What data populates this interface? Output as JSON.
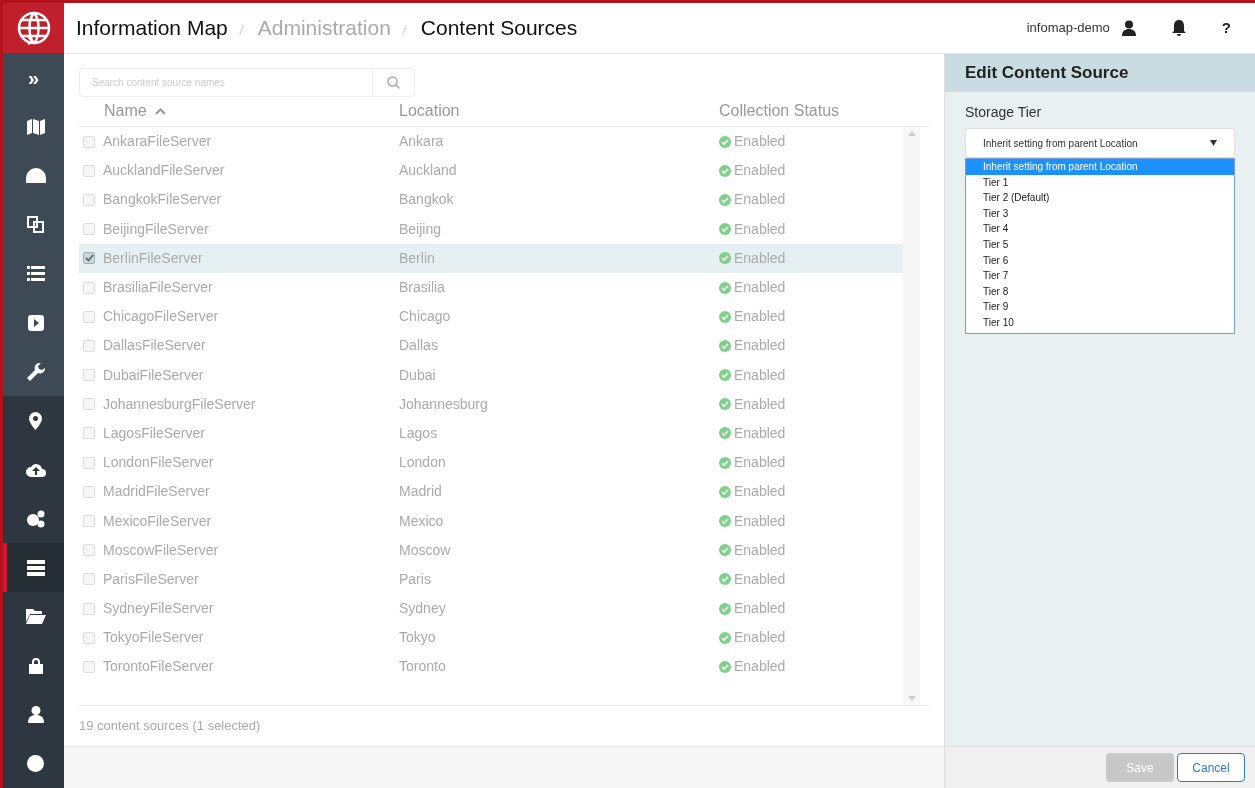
{
  "breadcrumb": [
    {
      "label": "Information Map",
      "muted": false
    },
    {
      "label": "Administration",
      "muted": true
    },
    {
      "label": "Content Sources",
      "muted": false
    }
  ],
  "user": {
    "name": "infomap-demo",
    "help": "?"
  },
  "sidebar": {
    "expand": "»",
    "nav_items": [
      {
        "selected": false
      },
      {
        "selected": false
      },
      {
        "selected": false
      },
      {
        "selected": false
      },
      {
        "selected": false
      },
      {
        "selected": false
      }
    ],
    "admin_items": [
      {
        "selected": false
      },
      {
        "selected": false
      },
      {
        "selected": false
      },
      {
        "selected": true
      },
      {
        "selected": false
      },
      {
        "selected": false
      },
      {
        "selected": false
      },
      {
        "selected": false
      }
    ]
  },
  "search": {
    "placeholder": "Search content source names"
  },
  "table": {
    "columns": [
      {
        "label": "Name",
        "sorted": true
      },
      {
        "label": "Location",
        "sorted": false
      },
      {
        "label": "Collection Status",
        "sorted": false
      }
    ],
    "rows": [
      {
        "name": "AnkaraFileServer",
        "location": "Ankara",
        "status": "Enabled",
        "checked": false,
        "selected": false
      },
      {
        "name": "AucklandFileServer",
        "location": "Auckland",
        "status": "Enabled",
        "checked": false,
        "selected": false
      },
      {
        "name": "BangkokFileServer",
        "location": "Bangkok",
        "status": "Enabled",
        "checked": false,
        "selected": false
      },
      {
        "name": "BeijingFileServer",
        "location": "Beijing",
        "status": "Enabled",
        "checked": false,
        "selected": false
      },
      {
        "name": "BerlinFileServer",
        "location": "Berlin",
        "status": "Enabled",
        "checked": true,
        "selected": true
      },
      {
        "name": "BrasiliaFileServer",
        "location": "Brasilia",
        "status": "Enabled",
        "checked": false,
        "selected": false
      },
      {
        "name": "ChicagoFileServer",
        "location": "Chicago",
        "status": "Enabled",
        "checked": false,
        "selected": false
      },
      {
        "name": "DallasFileServer",
        "location": "Dallas",
        "status": "Enabled",
        "checked": false,
        "selected": false
      },
      {
        "name": "DubaiFileServer",
        "location": "Dubai",
        "status": "Enabled",
        "checked": false,
        "selected": false
      },
      {
        "name": "JohannesburgFileServer",
        "location": "Johannesburg",
        "status": "Enabled",
        "checked": false,
        "selected": false
      },
      {
        "name": "LagosFileServer",
        "location": "Lagos",
        "status": "Enabled",
        "checked": false,
        "selected": false
      },
      {
        "name": "LondonFileServer",
        "location": "London",
        "status": "Enabled",
        "checked": false,
        "selected": false
      },
      {
        "name": "MadridFileServer",
        "location": "Madrid",
        "status": "Enabled",
        "checked": false,
        "selected": false
      },
      {
        "name": "MexicoFileServer",
        "location": "Mexico",
        "status": "Enabled",
        "checked": false,
        "selected": false
      },
      {
        "name": "MoscowFileServer",
        "location": "Moscow",
        "status": "Enabled",
        "checked": false,
        "selected": false
      },
      {
        "name": "ParisFileServer",
        "location": "Paris",
        "status": "Enabled",
        "checked": false,
        "selected": false
      },
      {
        "name": "SydneyFileServer",
        "location": "Sydney",
        "status": "Enabled",
        "checked": false,
        "selected": false
      },
      {
        "name": "TokyoFileServer",
        "location": "Tokyo",
        "status": "Enabled",
        "checked": false,
        "selected": false
      },
      {
        "name": "TorontoFileServer",
        "location": "Toronto",
        "status": "Enabled",
        "checked": false,
        "selected": false
      }
    ]
  },
  "footer": "19 content sources (1 selected)",
  "panel": {
    "title": "Edit Content Source",
    "field_label": "Storage Tier",
    "value": "Inherit setting from parent Location",
    "expanded": true,
    "options": [
      {
        "label": "Inherit setting from parent Location",
        "selected": true
      },
      {
        "label": "Tier 1",
        "selected": false
      },
      {
        "label": "Tier 2 (Default)",
        "selected": false
      },
      {
        "label": "Tier 3",
        "selected": false
      },
      {
        "label": "Tier 4",
        "selected": false
      },
      {
        "label": "Tier 5",
        "selected": false
      },
      {
        "label": "Tier 6",
        "selected": false
      },
      {
        "label": "Tier 7",
        "selected": false
      },
      {
        "label": "Tier 8",
        "selected": false
      },
      {
        "label": "Tier 9",
        "selected": false
      },
      {
        "label": "Tier 10",
        "selected": false
      }
    ],
    "buttons": [
      {
        "label": "Save",
        "disabled": true
      },
      {
        "label": "Cancel",
        "disabled": false
      }
    ]
  }
}
